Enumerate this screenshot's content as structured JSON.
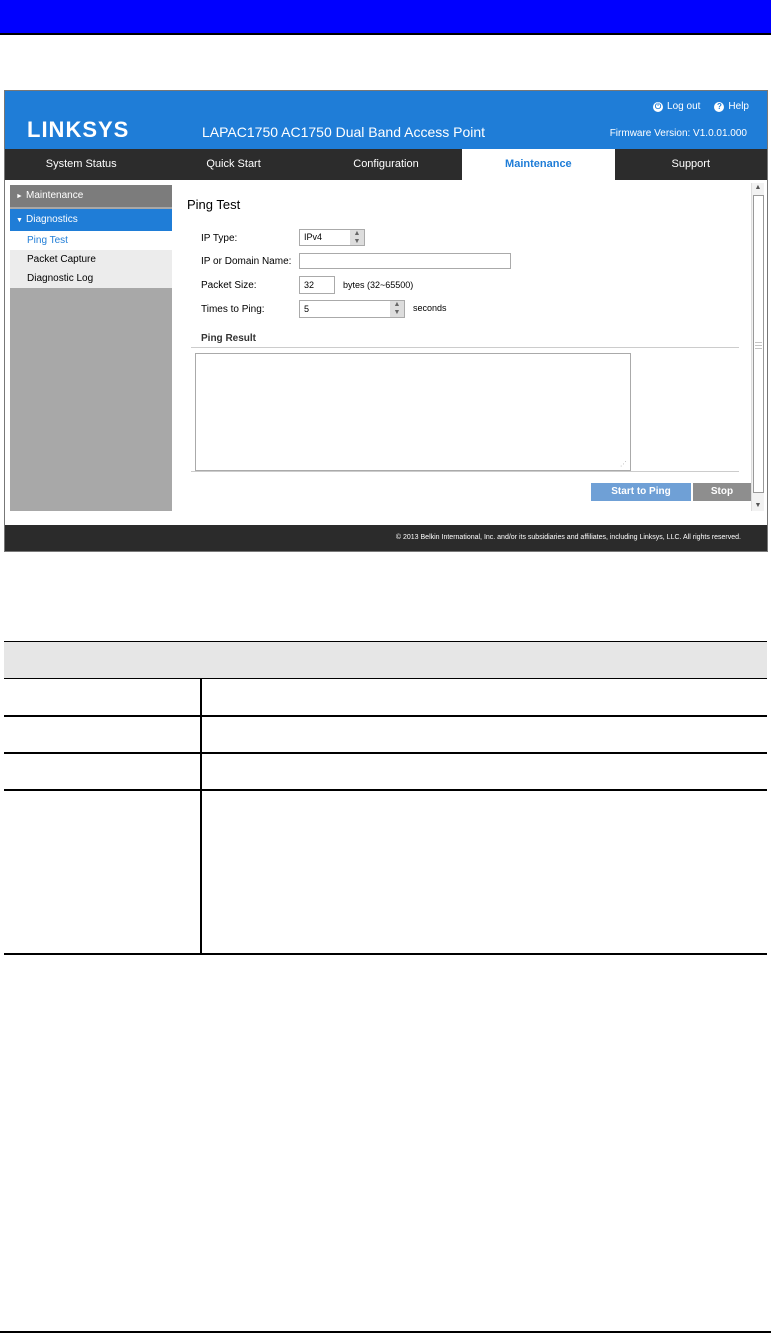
{
  "app": {
    "logo": "LINKSYS",
    "product_title": "LAPAC1750 AC1750 Dual Band Access Point",
    "logout_label": "Log out",
    "help_label": "Help",
    "firmware": "Firmware Version: V1.0.01.000"
  },
  "nav": {
    "tabs": [
      {
        "label": "System Status"
      },
      {
        "label": "Quick Start"
      },
      {
        "label": "Configuration"
      },
      {
        "label": "Maintenance"
      },
      {
        "label": "Support"
      }
    ]
  },
  "sidebar": {
    "maintenance": "Maintenance",
    "diagnostics": "Diagnostics",
    "items": [
      {
        "label": "Ping Test"
      },
      {
        "label": "Packet Capture"
      },
      {
        "label": "Diagnostic Log"
      }
    ]
  },
  "page": {
    "title": "Ping Test",
    "ip_type_label": "IP Type:",
    "ip_type_value": "IPv4",
    "ip_domain_label": "IP or Domain Name:",
    "ip_domain_value": "",
    "packet_size_label": "Packet Size:",
    "packet_size_value": "32",
    "packet_size_hint": "bytes (32~65500)",
    "times_label": "Times to Ping:",
    "times_value": "5",
    "times_hint": "seconds",
    "result_title": "Ping Result",
    "start_button": "Start to Ping",
    "stop_button": "Stop"
  },
  "footer": {
    "copyright": "© 2013 Belkin International, Inc. and/or its subsidiaries and affiliates, including Linksys, LLC. All rights reserved."
  },
  "colors": {
    "brand_blue": "#1f7dd7",
    "nav_dark": "#2c2c2c",
    "top_bar": "#0000ff"
  }
}
